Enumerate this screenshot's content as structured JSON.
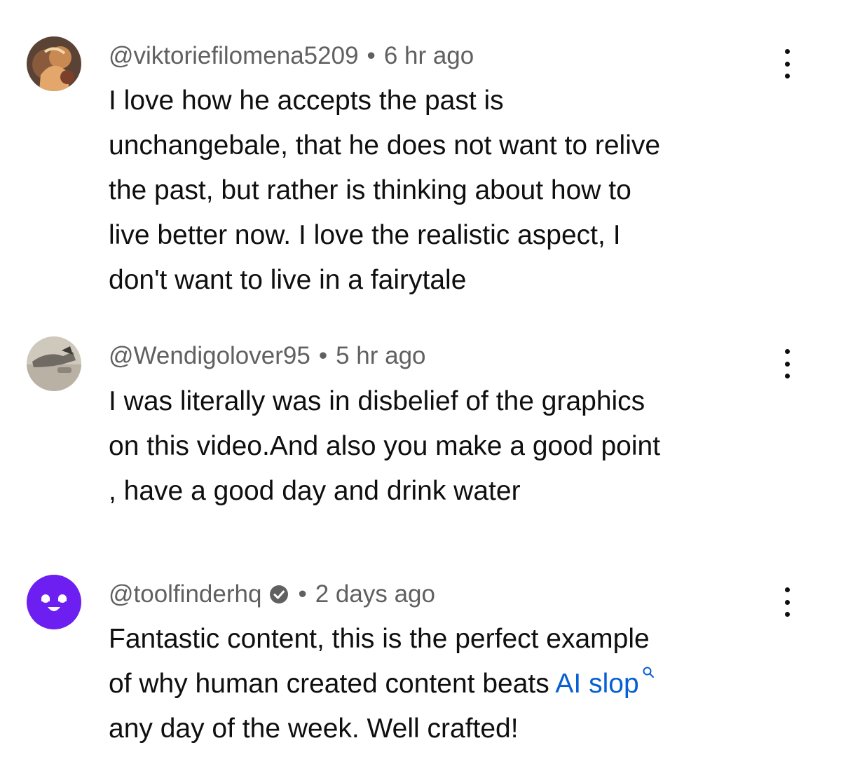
{
  "comments": [
    {
      "handle": "@viktoriefilomena5209",
      "separator": "•",
      "time": "6 hr ago",
      "avatar": "painting-avatar",
      "lines": [
        "I love how he accepts the past is",
        "unchangebale, that he does not want to relive",
        "the past, but rather is thinking about how to",
        "live better now. I love the realistic aspect, I",
        "don't want to live in a fairytale"
      ]
    },
    {
      "handle": "@Wendigolover95",
      "separator": "•",
      "time": "5 hr ago",
      "avatar": "photo-avatar",
      "lines": [
        "I was literally was in disbelief of the graphics",
        "on this video.And also you  make a good point",
        ", have a good day and drink water"
      ]
    },
    {
      "handle": "@toolfinderhq",
      "verified": true,
      "separator": "•",
      "time": "2 days ago",
      "avatar": "purple-logo-avatar",
      "line1": "Fantastic content, this is the perfect example",
      "line2_prefix": "of why human created content beats ",
      "line2_link": "AI slop",
      "line3": "any day of the week. Well crafted!"
    }
  ],
  "colors": {
    "text": "#0f0f0f",
    "meta": "#606060",
    "link": "#065fd4",
    "brand_purple": "#6c1ff0"
  },
  "icons": {
    "more": "vertical-ellipsis-icon",
    "verified": "verified-check-icon",
    "search": "search-icon"
  }
}
